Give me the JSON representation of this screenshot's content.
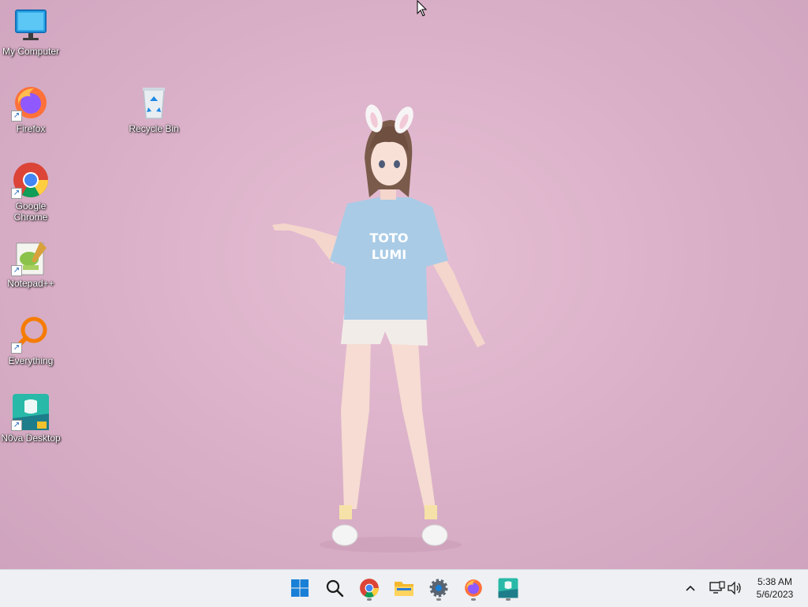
{
  "desktop_icons": [
    {
      "name": "my-computer",
      "label": "My Computer"
    },
    {
      "name": "firefox",
      "label": "Firefox"
    },
    {
      "name": "recycle-bin",
      "label": "Recycle Bin"
    },
    {
      "name": "google-chrome",
      "label": "Google Chrome"
    },
    {
      "name": "notepad-plus-plus",
      "label": "Notepad++"
    },
    {
      "name": "everything",
      "label": "Everything"
    },
    {
      "name": "n0va-desktop",
      "label": "N0va Desktop"
    }
  ],
  "wallpaper": {
    "shirt_text_line1": "TOTO",
    "shirt_text_line2": "LUMI"
  },
  "taskbar": {
    "apps": [
      {
        "icon": "windows-start-icon",
        "running": false
      },
      {
        "icon": "search-icon",
        "running": false
      },
      {
        "icon": "chrome-icon",
        "running": true
      },
      {
        "icon": "file-explorer-icon",
        "running": false
      },
      {
        "icon": "settings-gear-icon",
        "running": true
      },
      {
        "icon": "firefox-icon",
        "running": true
      },
      {
        "icon": "n0va-desktop-icon",
        "running": true
      }
    ],
    "tray": {
      "time": "5:38 AM",
      "date": "5/6/2023"
    }
  },
  "colors": {
    "wallpaper_pink": "#d9afc7",
    "taskbar_bg": "#eef0f3",
    "windows_blue": "#1a7fd6"
  }
}
